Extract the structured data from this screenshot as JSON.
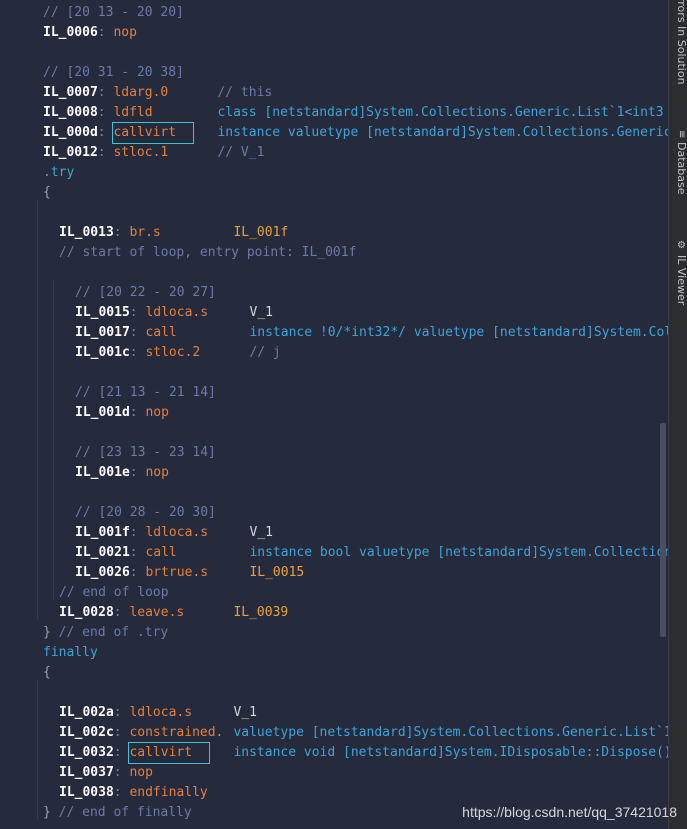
{
  "side_panel": {
    "tabs": [
      "Errors In Solution",
      "Database",
      "IL Viewer"
    ]
  },
  "code": {
    "lines": [
      {
        "n": 1,
        "t": "cm",
        "v": "// [20 13 - 20 20]"
      },
      {
        "n": 2,
        "label": "IL_0006",
        "op": "nop"
      },
      {
        "n": 4,
        "t": "cm",
        "v": "// [20 31 - 20 38]"
      },
      {
        "n": 5,
        "label": "IL_0007",
        "op": "ldarg.0",
        "cm": "// this"
      },
      {
        "n": 6,
        "label": "IL_0008",
        "op": "ldfld",
        "arg": "class [netstandard]System.Collections.Generic.List`1<int3"
      },
      {
        "n": 7,
        "label": "IL_000d",
        "op": "callvirt",
        "arg": "instance valuetype [netstandard]System.Collections.Generic"
      },
      {
        "n": 8,
        "label": "IL_0012",
        "op": "stloc.1",
        "cm": "// V_1"
      },
      {
        "n": 9,
        "t": "kw",
        "v": ".try"
      },
      {
        "n": 10,
        "t": "br",
        "v": "{"
      },
      {
        "n": 12,
        "label": "IL_0013",
        "op": "br.s",
        "target": "IL_001f"
      },
      {
        "n": 13,
        "t": "cm",
        "v": "// start of loop, entry point: IL_001f"
      },
      {
        "n": 15,
        "t": "cm",
        "v": "// [20 22 - 20 27]"
      },
      {
        "n": 16,
        "label": "IL_0015",
        "op": "ldloca.s",
        "plain": "V_1"
      },
      {
        "n": 17,
        "label": "IL_0017",
        "op": "call",
        "arg": "instance !0/*int32*/ valuetype [netstandard]System.Coll"
      },
      {
        "n": 18,
        "label": "IL_001c",
        "op": "stloc.2",
        "cm": "// j"
      },
      {
        "n": 20,
        "t": "cm",
        "v": "// [21 13 - 21 14]"
      },
      {
        "n": 21,
        "label": "IL_001d",
        "op": "nop"
      },
      {
        "n": 23,
        "t": "cm",
        "v": "// [23 13 - 23 14]"
      },
      {
        "n": 24,
        "label": "IL_001e",
        "op": "nop"
      },
      {
        "n": 26,
        "t": "cm",
        "v": "// [20 28 - 20 30]"
      },
      {
        "n": 27,
        "label": "IL_001f",
        "op": "ldloca.s",
        "plain": "V_1"
      },
      {
        "n": 28,
        "label": "IL_0021",
        "op": "call",
        "arg": "instance bool valuetype [netstandard]System.Collection"
      },
      {
        "n": 29,
        "label": "IL_0026",
        "op": "brtrue.s",
        "target": "IL_0015"
      },
      {
        "n": 30,
        "t": "cm",
        "v": "// end of loop"
      },
      {
        "n": 31,
        "label": "IL_0028",
        "op": "leave.s",
        "target": "IL_0039"
      },
      {
        "n": 32,
        "t": "br",
        "v": "}",
        "cm": "// end of .try"
      },
      {
        "n": 33,
        "t": "kw",
        "v": "finally"
      },
      {
        "n": 34,
        "t": "br",
        "v": "{"
      },
      {
        "n": 36,
        "label": "IL_002a",
        "op": "ldloca.s",
        "plain": "V_1"
      },
      {
        "n": 37,
        "label": "IL_002c",
        "op": "constrained.",
        "arg": "valuetype [netstandard]System.Collections.Generic.List`1"
      },
      {
        "n": 38,
        "label": "IL_0032",
        "op": "callvirt",
        "arg": "instance void [netstandard]System.IDisposable::Dispose()"
      },
      {
        "n": 39,
        "label": "IL_0037",
        "op": "nop"
      },
      {
        "n": 40,
        "label": "IL_0038",
        "op": "endfinally"
      },
      {
        "n": 41,
        "t": "br",
        "v": "}",
        "cm": "// end of finally"
      }
    ]
  },
  "watermark": "https://blog.csdn.net/qq_37421018"
}
